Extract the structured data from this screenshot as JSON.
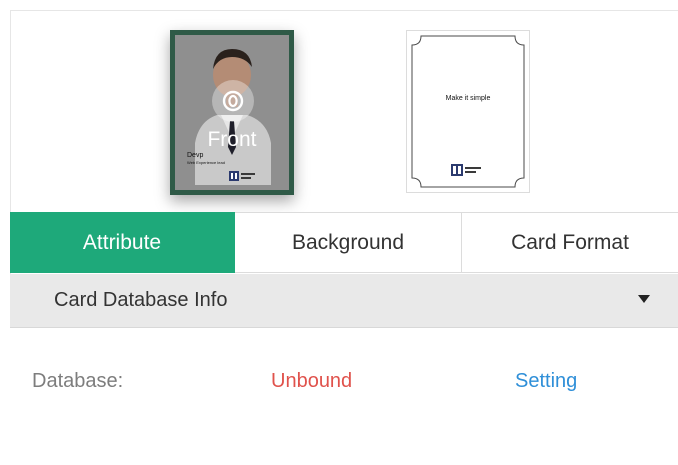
{
  "cards": {
    "front": {
      "label": "Front",
      "name": "Devp",
      "subname": "Web Experience lead",
      "frame_color": "#2f5a47"
    },
    "back": {
      "text": "Make it simple"
    }
  },
  "tabs": [
    {
      "label": "Attribute",
      "active": true
    },
    {
      "label": "Background",
      "active": false
    },
    {
      "label": "Card Format",
      "active": false
    }
  ],
  "section": {
    "title": "Card Database Info",
    "caret_icon": "caret-down-icon"
  },
  "database": {
    "label": "Database:",
    "status": "Unbound",
    "setting_link": "Setting"
  },
  "colors": {
    "accent": "#1ea97a",
    "status_unbound": "#e0524c",
    "link": "#2f8fd8"
  }
}
